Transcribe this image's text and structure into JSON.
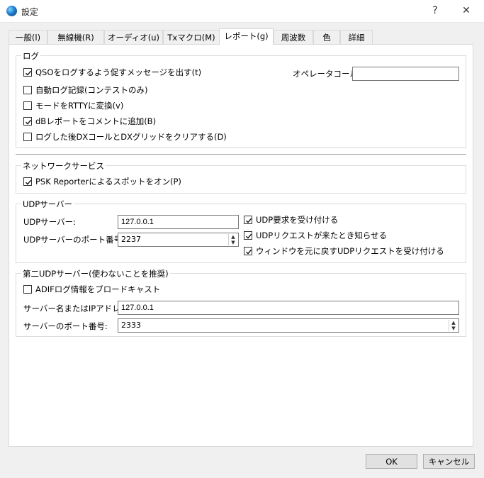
{
  "window": {
    "title": "設定",
    "help": "?",
    "close": "✕"
  },
  "tabs": [
    {
      "label": "一般(l)"
    },
    {
      "label": "無線機(R)"
    },
    {
      "label": "オーディオ(u)"
    },
    {
      "label": "Txマクロ(M)"
    },
    {
      "label": "レポート(g)"
    },
    {
      "label": "周波数"
    },
    {
      "label": "色"
    },
    {
      "label": "詳細"
    }
  ],
  "active_tab": "レポート(g)",
  "log": {
    "title": "ログ",
    "items": [
      {
        "label": "QSOをログするよう促すメッセージを出す(t)",
        "checked": true
      },
      {
        "label": "自動ログ記録(コンテストのみ)",
        "checked": false
      },
      {
        "label": "モードをRTTYに変換(v)",
        "checked": false
      },
      {
        "label": "dBレポートをコメントに追加(B)",
        "checked": true
      },
      {
        "label": "ログした後DXコールとDXグリッドをクリアする(D)",
        "checked": false
      }
    ],
    "operator_label": "オペレータコール:",
    "operator_value": ""
  },
  "network": {
    "title": "ネットワークサービス",
    "psk_label": "PSK Reporterによるスポットをオン(P)",
    "psk_checked": true
  },
  "udp": {
    "title": "UDPサーバー",
    "server_label": "UDPサーバー:",
    "server_value": "127.0.0.1",
    "port_label": "UDPサーバーのポート番号:",
    "port_value": "2237",
    "options": [
      {
        "label": "UDP要求を受け付ける",
        "checked": true
      },
      {
        "label": "UDPリクエストが来たとき知らせる",
        "checked": true
      },
      {
        "label": "ウィンドウを元に戻すUDPリクエストを受け付ける",
        "checked": true
      }
    ]
  },
  "udp2": {
    "title": "第二UDPサーバー(使わないことを推奨)",
    "adif_label": "ADIFログ情報をブロードキャスト",
    "adif_checked": false,
    "server_label": "サーバー名またはIPアドレス:",
    "server_value": "127.0.0.1",
    "port_label": "サーバーのポート番号:",
    "port_value": "2333"
  },
  "buttons": {
    "ok": "OK",
    "cancel": "キャンセル"
  }
}
